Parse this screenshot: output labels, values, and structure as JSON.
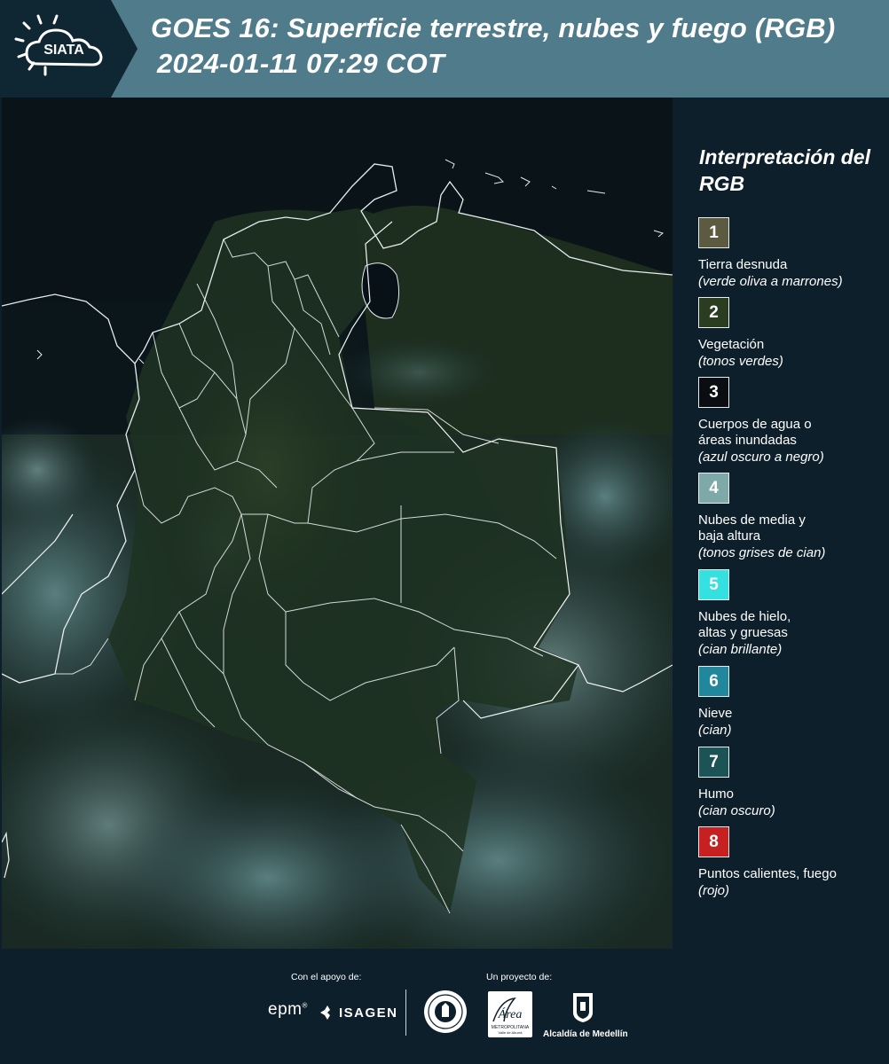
{
  "header": {
    "logo_text": "SIATA",
    "title_line1": "GOES 16: Superficie terrestre, nubes y fuego (RGB)",
    "title_line2": "2024-01-11 07:29 COT"
  },
  "legend": {
    "title": "Interpretación del RGB",
    "items": [
      {
        "number": "1",
        "label": "Tierra desnuda",
        "sub": "(verde oliva a marrones)",
        "color": "#5c5a40"
      },
      {
        "number": "2",
        "label": "Vegetación",
        "sub": "(tonos verdes)",
        "color": "#2b3d21"
      },
      {
        "number": "3",
        "label": "Cuerpos de agua o áreas inundadas",
        "sub": "(azul oscuro a negro)",
        "color": "#0a0d12"
      },
      {
        "number": "4",
        "label": "Nubes de media y baja altura",
        "sub": "(tonos grises de cian)",
        "color": "#7fa9a9"
      },
      {
        "number": "5",
        "label": "Nubes de hielo, altas y gruesas",
        "sub": "(cian brillante)",
        "color": "#35e0e0"
      },
      {
        "number": "6",
        "label": "Nieve",
        "sub": "(cian)",
        "color": "#21879c"
      },
      {
        "number": "7",
        "label": "Humo",
        "sub": "(cian oscuro)",
        "color": "#1c5356"
      },
      {
        "number": "8",
        "label": "Puntos calientes, fuego",
        "sub": "(rojo)",
        "color": "#c62020"
      }
    ]
  },
  "footer": {
    "support_label": "Con el apoyo de:",
    "project_label": "Un proyecto de:",
    "epm": "epm",
    "isagen": "ISAGEN",
    "area_name": "Área",
    "area_sub": "METROPOLITANA",
    "area_sub2": "Valle de Aburrá",
    "alcaldia": "Alcaldía de Medellín"
  }
}
